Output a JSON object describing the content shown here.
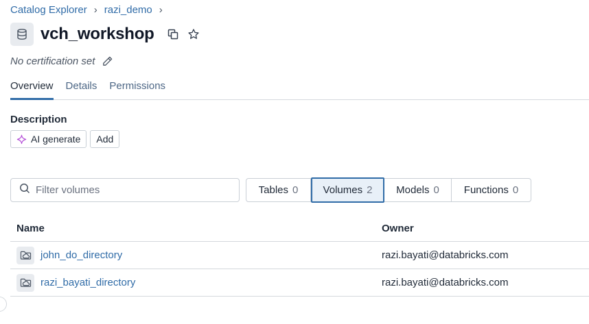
{
  "breadcrumb": {
    "items": [
      "Catalog Explorer",
      "razi_demo"
    ],
    "separator": "›"
  },
  "header": {
    "title": "vch_workshop",
    "icon": "database-icon"
  },
  "certification": {
    "text": "No certification set"
  },
  "tabs": [
    {
      "label": "Overview",
      "active": true
    },
    {
      "label": "Details",
      "active": false
    },
    {
      "label": "Permissions",
      "active": false
    }
  ],
  "description": {
    "label": "Description",
    "ai_generate_label": "AI generate",
    "add_label": "Add"
  },
  "filter": {
    "placeholder": "Filter volumes",
    "value": ""
  },
  "segments": [
    {
      "label": "Tables",
      "count": "0",
      "active": false
    },
    {
      "label": "Volumes",
      "count": "2",
      "active": true
    },
    {
      "label": "Models",
      "count": "0",
      "active": false
    },
    {
      "label": "Functions",
      "count": "0",
      "active": false
    }
  ],
  "table": {
    "columns": [
      "Name",
      "Owner"
    ],
    "rows": [
      {
        "name": "john_do_directory",
        "owner": "razi.bayati@databricks.com"
      },
      {
        "name": "razi_bayati_directory",
        "owner": "razi.bayati@databricks.com"
      }
    ]
  },
  "colors": {
    "accent": "#2f6ba7",
    "active_segment_bg": "#e8f0f8",
    "border": "#c9cfd6",
    "icon_bg": "#e8ebef",
    "ai_sparkle": "#b44fd8"
  }
}
